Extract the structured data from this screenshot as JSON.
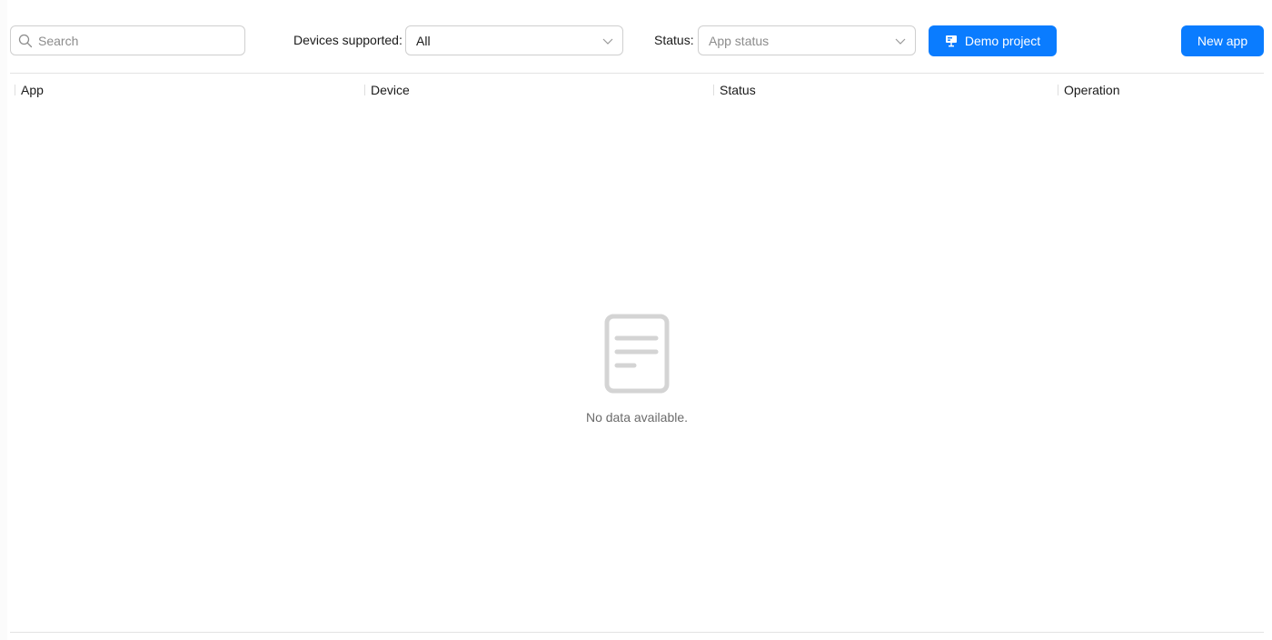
{
  "toolbar": {
    "search": {
      "placeholder": "Search",
      "value": ""
    },
    "devices_filter": {
      "label": "Devices supported:",
      "value": "All"
    },
    "status_filter": {
      "label": "Status:",
      "placeholder": "App status"
    },
    "demo_button": {
      "label": "Demo project",
      "icon": "presentation-icon"
    },
    "new_app_button": {
      "label": "New app"
    }
  },
  "table": {
    "columns": [
      "App",
      "Device",
      "Status",
      "Operation"
    ],
    "rows": [],
    "empty_text": "No data available.",
    "empty_icon": "document-icon"
  },
  "colors": {
    "primary": "#0a7cff",
    "border": "#cfcfcf",
    "muted_text": "#6b6b6b",
    "empty_icon": "#d4d4d4"
  }
}
